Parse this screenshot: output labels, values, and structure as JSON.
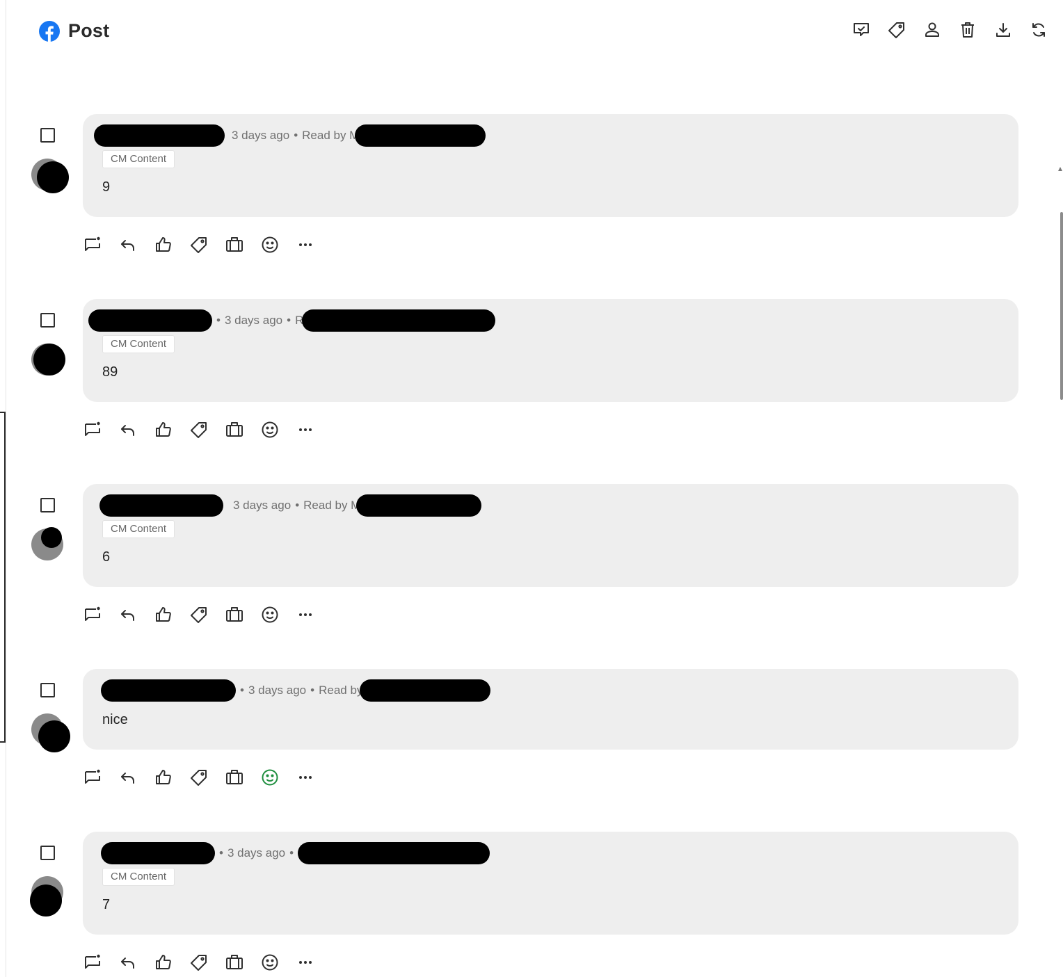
{
  "header": {
    "title": "Post",
    "logo": "facebook-logo",
    "tools": [
      {
        "name": "mark-read-icon",
        "label": "Mark as read"
      },
      {
        "name": "tag-icon",
        "label": "Tag"
      },
      {
        "name": "assign-user-icon",
        "label": "Assign"
      },
      {
        "name": "delete-icon",
        "label": "Delete"
      },
      {
        "name": "download-icon",
        "label": "Download"
      },
      {
        "name": "refresh-icon",
        "label": "Refresh"
      }
    ]
  },
  "comments": [
    {
      "time": "3 days ago",
      "read_by": "Read by M",
      "tag": "CM Content",
      "text": "9"
    },
    {
      "time": "3 days ago",
      "read_by": "R",
      "tag": "CM Content",
      "text": "89"
    },
    {
      "time": "3 days ago",
      "read_by": "Read by M",
      "tag": "CM Content",
      "text": "6"
    },
    {
      "time": "3 days ago",
      "read_by": "Read by",
      "tag": "",
      "text": "nice"
    },
    {
      "time": "3 days ago",
      "read_by": "",
      "tag": "CM Content",
      "text": "7"
    }
  ],
  "action_icons": [
    "add-comment-icon",
    "reply-icon",
    "like-icon",
    "tag-icon",
    "briefcase-icon",
    "sentiment-icon",
    "more-icon"
  ],
  "colors": {
    "facebook_blue": "#1877F2",
    "bubble_bg": "#EEEEEE",
    "positive_sentiment": "#1E8E3E",
    "icon": "#2F2F2F"
  }
}
